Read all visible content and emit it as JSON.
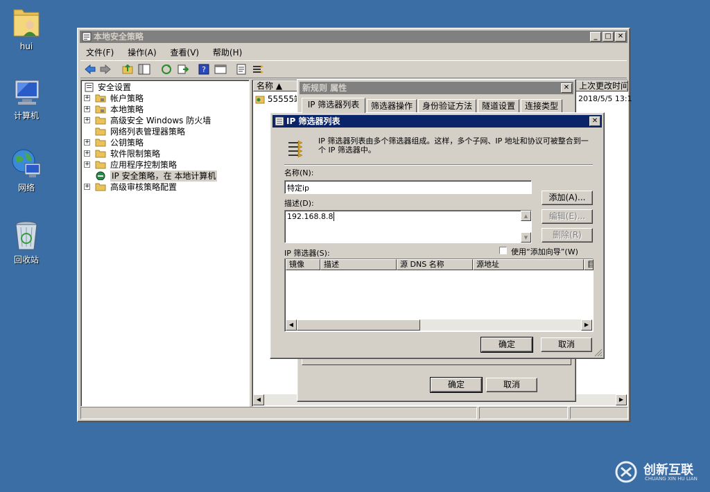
{
  "desktop": {
    "icons": [
      {
        "label": "hui"
      },
      {
        "label": "计算机"
      },
      {
        "label": "网络"
      },
      {
        "label": "回收站"
      }
    ]
  },
  "main_window": {
    "title": "本地安全策略",
    "menu": [
      "文件(F)",
      "操作(A)",
      "查看(V)",
      "帮助(H)"
    ],
    "tree": [
      {
        "label": "安全设置",
        "expander": ""
      },
      {
        "label": "帐户策略",
        "expander": "+"
      },
      {
        "label": "本地策略",
        "expander": "+"
      },
      {
        "label": "高级安全 Windows 防火墙",
        "expander": "+"
      },
      {
        "label": "网络列表管理器策略",
        "expander": ""
      },
      {
        "label": "公钥策略",
        "expander": "+"
      },
      {
        "label": "软件限制策略",
        "expander": "+"
      },
      {
        "label": "应用程序控制策略",
        "expander": "+"
      },
      {
        "label": "IP 安全策略，在 本地计算机",
        "expander": ""
      },
      {
        "label": "高级审核策略配置",
        "expander": "+"
      }
    ],
    "list": {
      "columns": [
        "名称",
        "上次更改时间"
      ],
      "rows": [
        {
          "name": "55555端",
          "modified": "2018/5/5 13:1"
        }
      ]
    }
  },
  "rule_dialog": {
    "title": "新规则 属性",
    "tabs": [
      "IP 筛选器列表",
      "筛选器操作",
      "身份验证方法",
      "隧道设置",
      "连接类型"
    ],
    "ok_label": "确定",
    "cancel_label": "取消"
  },
  "filter_dialog": {
    "title": "IP 筛选器列表",
    "description_text": "IP 筛选器列表由多个筛选器组成。这样，多个子网、IP 地址和协议可被整合到一个 IP 筛选器中。",
    "name_label": "名称(N):",
    "name_value": "特定ip",
    "desc_label": "描述(D):",
    "desc_value": "192.168.8.8",
    "add_label": "添加(A)...",
    "edit_label": "编辑(E)...",
    "remove_label": "删除(R)",
    "filters_label": "IP 筛选器(S):",
    "wizard_label": "使用“添加向导”(W)",
    "columns": [
      "镜像",
      "描述",
      "源 DNS 名称",
      "源地址",
      "目"
    ],
    "ok_label": "确定",
    "cancel_label": "取消"
  },
  "watermark": {
    "brand": "创新互联",
    "sub": "CHUANG XIN HU LIAN"
  }
}
